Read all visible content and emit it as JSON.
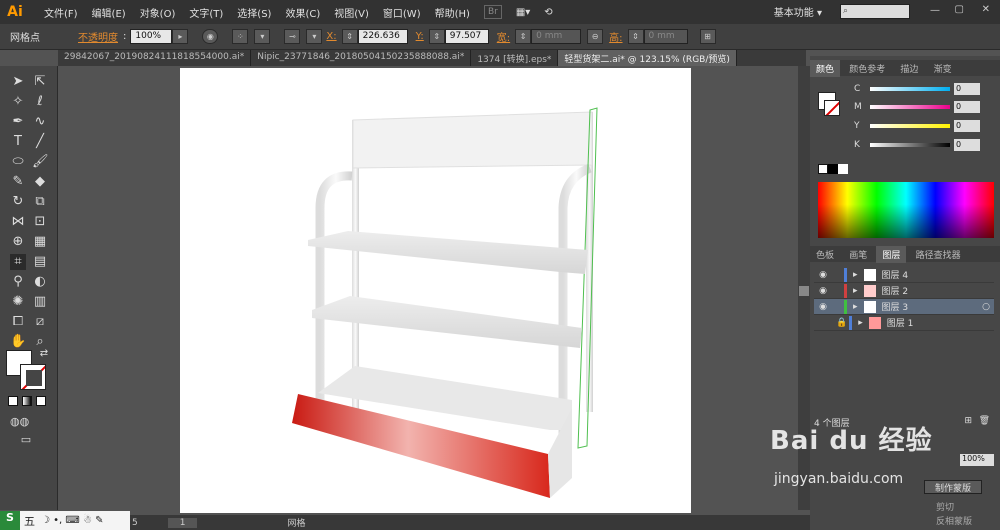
{
  "app": {
    "logo": "Ai"
  },
  "menu": [
    "文件(F)",
    "编辑(E)",
    "对象(O)",
    "文字(T)",
    "选择(S)",
    "效果(C)",
    "视图(V)",
    "窗口(W)",
    "帮助(H)"
  ],
  "menu_badge": "Br",
  "workspace": "基本功能",
  "control": {
    "mode": "网格点",
    "opacity_label": "不透明度",
    "opacity_value": "100%",
    "x_label": "X:",
    "x_value": "226.636",
    "y_label": "Y:",
    "y_value": "97.507",
    "w_label": "宽:",
    "w_value": "0 mm",
    "h_label": "高:",
    "h_value": "0 mm"
  },
  "tabs": [
    {
      "label": "29842067_20190824111818554000.ai*",
      "active": false
    },
    {
      "label": "Nipic_23771846_20180504150235888088.ai*",
      "active": false
    },
    {
      "label": "1374 [转换].eps*",
      "active": false
    },
    {
      "label": "轻型货架二.ai* @ 123.15% (RGB/预览)",
      "active": true
    }
  ],
  "color_panel": {
    "tabs": [
      "颜色",
      "颜色参考",
      "描边",
      "渐变"
    ],
    "channels": [
      {
        "label": "C",
        "value": "0",
        "gradient": "linear-gradient(90deg,#fff,#00aeef)"
      },
      {
        "label": "M",
        "value": "0",
        "gradient": "linear-gradient(90deg,#fff,#ec008c)"
      },
      {
        "label": "Y",
        "value": "0",
        "gradient": "linear-gradient(90deg,#fff,#fff200)"
      },
      {
        "label": "K",
        "value": "0",
        "gradient": "linear-gradient(90deg,#fff,#000)"
      }
    ]
  },
  "layers_panel": {
    "tabs": [
      "色板",
      "画笔",
      "图层",
      "路径查找器"
    ],
    "layers": [
      {
        "name": "图层 4",
        "color": "#4f7fd8",
        "selected": false,
        "locked": false
      },
      {
        "name": "图层 2",
        "color": "#d04040",
        "selected": false,
        "locked": false
      },
      {
        "name": "图层 3",
        "color": "#40c040",
        "selected": true,
        "locked": false
      },
      {
        "name": "图层 1",
        "color": "#4f7fd8",
        "selected": false,
        "locked": true
      }
    ],
    "count": "4 个图层"
  },
  "transparency": {
    "value": "100%",
    "make_mask": "制作蒙版",
    "clip": "剪切",
    "invert": "反相蒙版"
  },
  "status": {
    "zoom": "5",
    "page": "1",
    "mode": "网格"
  },
  "ime": {
    "label": "五"
  },
  "watermark": {
    "brand": "Bai du 经验",
    "url": "jingyan.baidu.com"
  },
  "colors": {
    "accent": "#ff9a00",
    "shelf_red": "#d8281c",
    "selection": "#5d6b7d"
  }
}
